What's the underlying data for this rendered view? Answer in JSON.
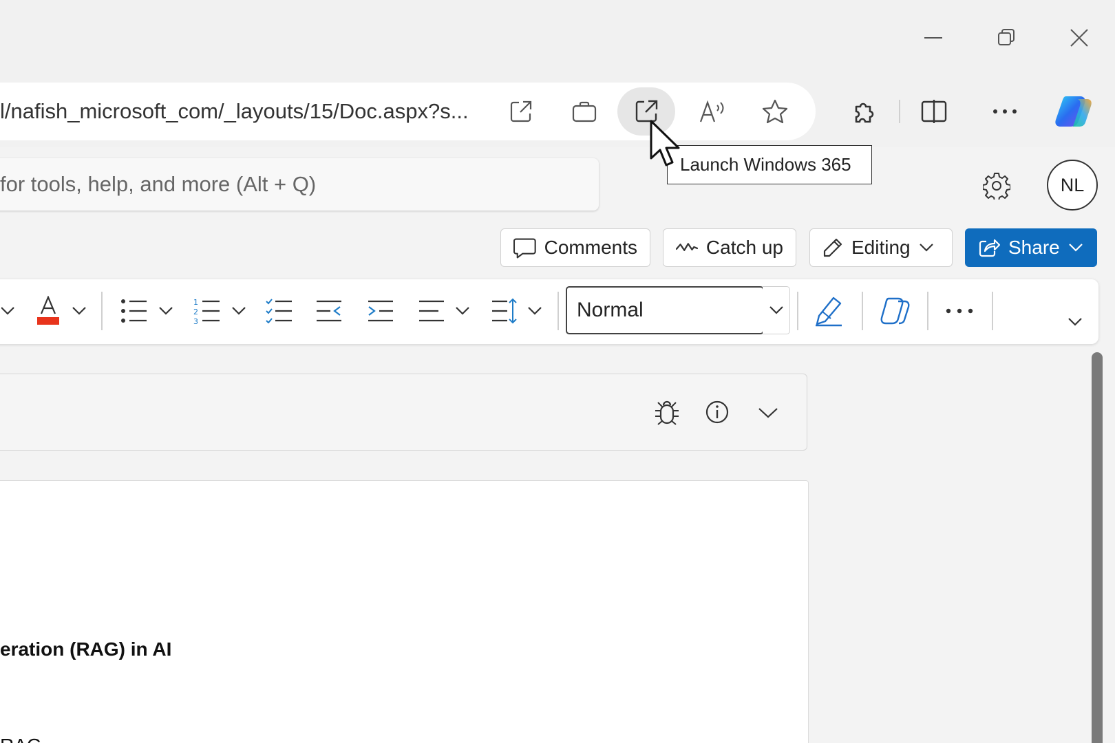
{
  "browser": {
    "url_text": "l/nafish_microsoft_com/_layouts/15/Doc.aspx?s...",
    "tooltip": "Launch Windows 365"
  },
  "word": {
    "search_placeholder": "for tools, help, and more (Alt + Q)",
    "avatar_initials": "NL",
    "buttons": {
      "comments": "Comments",
      "catch_up": "Catch up",
      "editing": "Editing",
      "share": "Share"
    },
    "style_value": "Normal",
    "font_color": "#e8341c",
    "accent": "#0f6cbd"
  },
  "document": {
    "heading_fragment": "eration (RAG) in AI",
    "text_fragment": "RAG"
  }
}
